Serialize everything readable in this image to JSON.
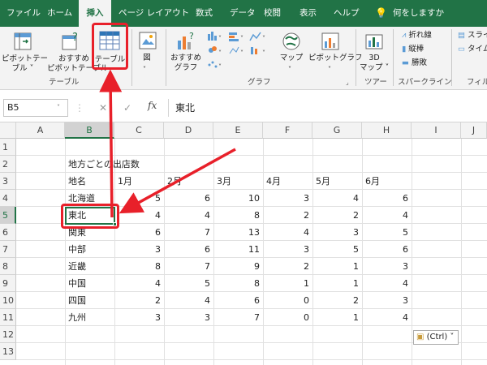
{
  "ribbon_tabs": [
    "ファイル",
    "ホーム",
    "挿入",
    "ページ レイアウト",
    "数式",
    "データ",
    "校閲",
    "表示",
    "ヘルプ",
    "何をしますか"
  ],
  "ribbon": {
    "pivot_table": [
      "ピボットテー",
      "ブル ˅"
    ],
    "recommended_pivot": [
      "おすすめ",
      "ピボットテーブル"
    ],
    "table": "テーブル",
    "illustrations": "図",
    "recommended_charts": [
      "おすすめ",
      "グラフ"
    ],
    "maps": "マップ",
    "pivot_chart": "ピボットグラフ",
    "map_3d": [
      "3D",
      "マップ ˅"
    ],
    "spark_line": "折れ線",
    "spark_column": "縦棒",
    "spark_winloss": "勝敗",
    "slicer": "スライ",
    "timeline": "タイム",
    "group_table": "テーブル",
    "group_chart": "グラフ",
    "group_tour": "ツアー",
    "group_sparkline": "スパークライン",
    "group_filter": "フィル"
  },
  "formula_bar": {
    "name_box": "B5",
    "fx": "fx",
    "cancel": "✕",
    "enter": "✓",
    "value": "東北"
  },
  "columns": [
    "A",
    "B",
    "C",
    "D",
    "E",
    "F",
    "G",
    "H",
    "I",
    "J"
  ],
  "rows": [
    "1",
    "2",
    "3",
    "4",
    "5",
    "6",
    "7",
    "8",
    "9",
    "10",
    "11",
    "12",
    "13"
  ],
  "sheet": {
    "title": "地方ごとの出店数",
    "header": [
      "地名",
      "1月",
      "2月",
      "3月",
      "4月",
      "5月",
      "6月"
    ],
    "data": [
      [
        "北海道",
        "5",
        "6",
        "10",
        "3",
        "4",
        "6"
      ],
      [
        "東北",
        "4",
        "4",
        "8",
        "2",
        "2",
        "4"
      ],
      [
        "関東",
        "6",
        "7",
        "13",
        "4",
        "3",
        "5"
      ],
      [
        "中部",
        "3",
        "6",
        "11",
        "3",
        "5",
        "6"
      ],
      [
        "近畿",
        "8",
        "7",
        "9",
        "2",
        "1",
        "3"
      ],
      [
        "中国",
        "4",
        "5",
        "8",
        "1",
        "1",
        "4"
      ],
      [
        "四国",
        "2",
        "4",
        "6",
        "0",
        "2",
        "3"
      ],
      [
        "九州",
        "3",
        "3",
        "7",
        "0",
        "1",
        "4"
      ]
    ]
  },
  "paste_options": "(Ctrl) ˅",
  "colors": {
    "excel_green": "#217346",
    "highlight_red": "#e8202a"
  }
}
